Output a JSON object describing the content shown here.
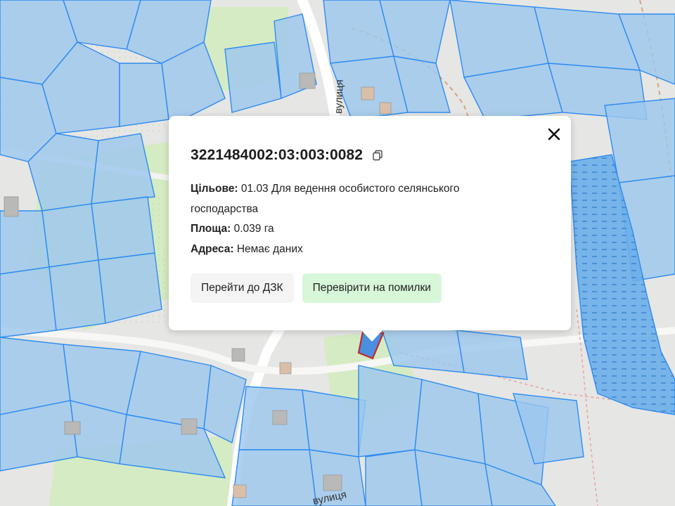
{
  "map": {
    "street_labels": [
      "вулиця",
      "вулиця"
    ],
    "colors": {
      "background": "#e6e6e4",
      "parcel_fill": "#9cc7ee",
      "parcel_stroke": "#2e8cf0",
      "green_area": "#d5ebc3",
      "water": "#6aaeea",
      "selected_parcel_stroke": "#c62828"
    }
  },
  "popup": {
    "cadastral_number": "3221484002:03:003:0082",
    "purpose_label": "Цільове:",
    "purpose_value": "01.03 Для ведення особистого селянського господарства",
    "area_label": "Площа:",
    "area_value": "0.039 га",
    "address_label": "Адреса:",
    "address_value": "Немає даних",
    "buttons": {
      "go_to_dzk": "Перейти до ДЗК",
      "check_errors": "Перевірити на помилки"
    },
    "icons": {
      "close": "close-icon",
      "copy": "copy-icon"
    }
  }
}
